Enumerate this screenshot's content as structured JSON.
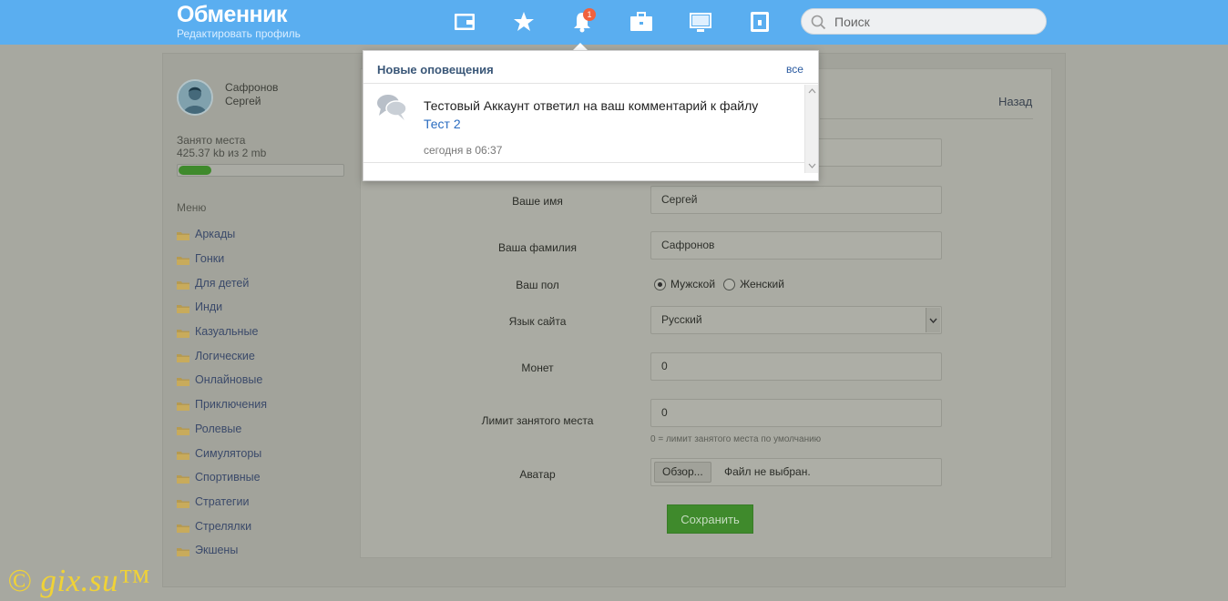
{
  "header": {
    "brand_title": "Обменник",
    "brand_subtitle": "Редактировать профиль",
    "notification_count": "1",
    "search_placeholder": "Поиск",
    "nav_icons": [
      "wallet-icon",
      "star-icon",
      "bell-icon",
      "briefcase-icon",
      "monitor-icon",
      "phone-icon"
    ]
  },
  "sidebar": {
    "user_first": "Сафронов",
    "user_last": "Сергей",
    "storage_label": "Занято места",
    "storage_value": "425.37 kb из 2 mb",
    "storage_fraction": 0.2,
    "menu_title": "Меню",
    "menu_items": [
      "Аркады",
      "Гонки",
      "Для детей",
      "Инди",
      "Казуальные",
      "Логические",
      "Онлайновые",
      "Приключения",
      "Ролевые",
      "Симуляторы",
      "Спортивные",
      "Стратегии",
      "Стрелялки",
      "Экшены"
    ]
  },
  "form": {
    "back_label": "Назад",
    "name_label": "Ваше имя",
    "name_value": "Сергей",
    "surname_label": "Ваша фамилия",
    "surname_value": "Сафронов",
    "gender_label": "Ваш пол",
    "gender_male": "Мужской",
    "gender_female": "Женский",
    "gender_selected": "Мужской",
    "lang_label": "Язык сайта",
    "lang_value": "Русский",
    "coins_label": "Монет",
    "coins_value": "0",
    "limit_label": "Лимит занятого места",
    "limit_value": "0",
    "limit_hint": "0 = лимит занятого места по умолчанию",
    "avatar_label": "Аватар",
    "avatar_button": "Обзор...",
    "avatar_status": "Файл не выбран.",
    "save_label": "Сохранить"
  },
  "notifications": {
    "title": "Новые оповещения",
    "all_link": "все",
    "items": [
      {
        "text": "Тестовый Аккаунт ответил на ваш комментарий к файлу",
        "link": "Тест 2",
        "time": "сегодня в 06:37"
      }
    ]
  },
  "watermark": "© gix.su™",
  "colors": {
    "header_bg": "#5aaef0",
    "accent_green": "#3f8a2c",
    "badge": "#f0623e",
    "link": "#2a6cc0"
  }
}
